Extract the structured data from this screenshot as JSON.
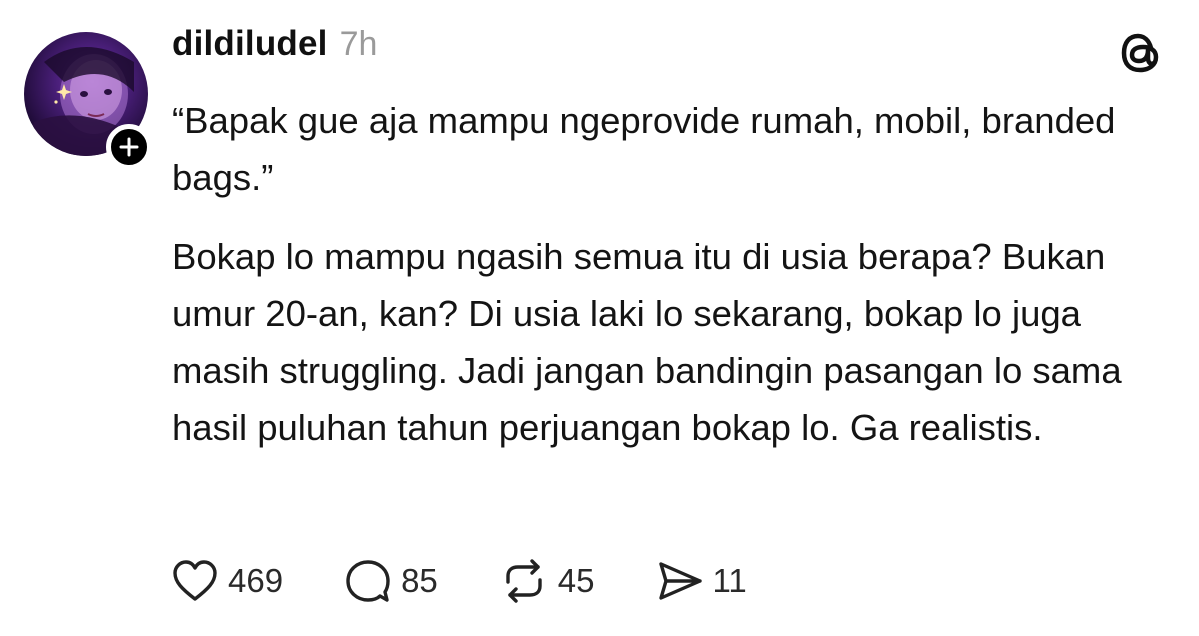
{
  "author": {
    "username": "dildiludel",
    "time": "7h",
    "avatar": "avatar-photo",
    "follow_icon": "plus-icon"
  },
  "app": {
    "logo_icon": "threads-logo-icon"
  },
  "post": {
    "paragraph_1": "“Bapak gue aja mampu ngeprovide rumah, mobil, branded bags.”",
    "paragraph_2": "Bokap lo mampu ngasih semua itu di usia berapa? Bukan umur 20-an, kan? Di usia laki lo sekarang, bokap lo juga masih struggling. Jadi jangan bandingin pasangan lo sama hasil puluhan tahun perjuangan bokap lo. Ga realistis."
  },
  "actions": {
    "like": {
      "icon": "heart-icon",
      "count": "469"
    },
    "reply": {
      "icon": "comment-icon",
      "count": "85"
    },
    "repost": {
      "icon": "repost-icon",
      "count": "45"
    },
    "share": {
      "icon": "send-icon",
      "count": "11"
    }
  }
}
